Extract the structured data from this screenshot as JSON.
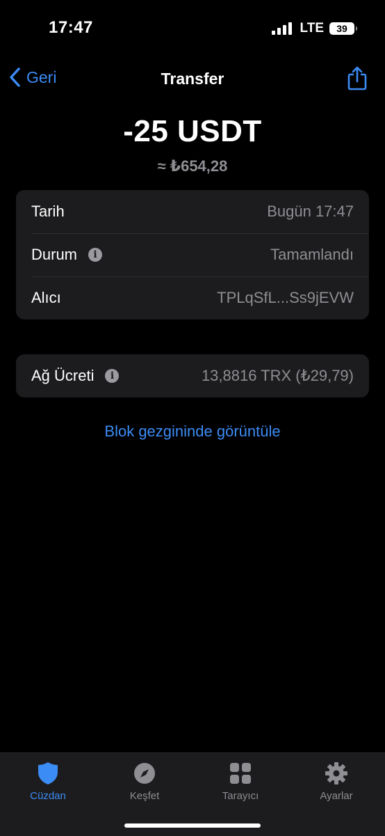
{
  "status_bar": {
    "time": "17:47",
    "network": "LTE",
    "battery": "39"
  },
  "nav": {
    "back_label": "Geri",
    "title": "Transfer"
  },
  "transaction": {
    "amount": "-25 USDT",
    "fiat_amount": "≈ ₺654,28"
  },
  "details": [
    {
      "label": "Tarih",
      "value": "Bugün 17:47",
      "info": false
    },
    {
      "label": "Durum",
      "value": "Tamamlandı",
      "info": true
    },
    {
      "label": "Alıcı",
      "value": "TPLqSfL...Ss9jEVW",
      "info": false
    }
  ],
  "fee": {
    "label": "Ağ Ücreti",
    "value": "13,8816 TRX (₺29,79)"
  },
  "explorer_link": "Blok gezgininde görüntüle",
  "tabs": [
    {
      "label": "Cüzdan",
      "icon": "shield-icon",
      "active": true
    },
    {
      "label": "Keşfet",
      "icon": "compass-icon",
      "active": false
    },
    {
      "label": "Tarayıcı",
      "icon": "grid-icon",
      "active": false
    },
    {
      "label": "Ayarlar",
      "icon": "gear-icon",
      "active": false
    }
  ],
  "colors": {
    "accent": "#3c8cf5",
    "background": "#000000",
    "card": "#1c1c1e",
    "secondary_text": "#8e8e93"
  }
}
